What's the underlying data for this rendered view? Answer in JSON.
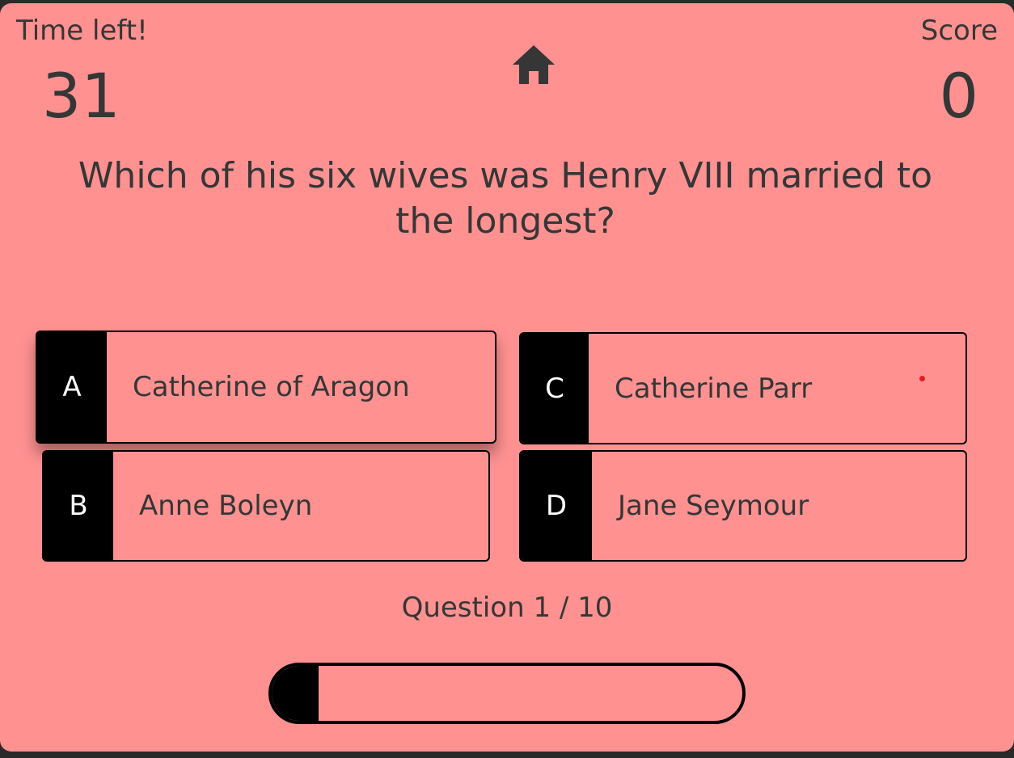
{
  "header": {
    "time_label": "Time left!",
    "time_value": "31",
    "score_label": "Score",
    "score_value": "0",
    "home_icon": "home-icon"
  },
  "question": {
    "text": "Which of his six wives was Henry VIII married to the longest?"
  },
  "answers": [
    {
      "letter": "A",
      "text": "Catherine of Aragon"
    },
    {
      "letter": "B",
      "text": "Anne Boleyn"
    },
    {
      "letter": "C",
      "text": "Catherine Parr"
    },
    {
      "letter": "D",
      "text": "Jane Seymour"
    }
  ],
  "progress": {
    "label": "Question 1 / 10",
    "fraction": 0.1
  },
  "colors": {
    "background": "#ff9191",
    "text": "#363636",
    "accent": "#000000",
    "dot": "#e02020"
  }
}
